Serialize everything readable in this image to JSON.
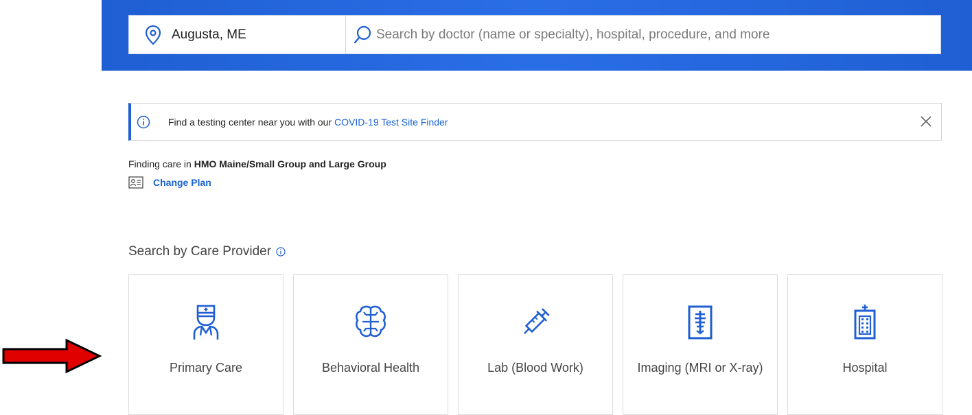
{
  "search": {
    "location_value": "Augusta, ME",
    "query_placeholder": "Search by doctor (name or specialty), hospital, procedure, and more"
  },
  "alert": {
    "text_prefix": "Find a testing center near you with our ",
    "link_text": "COVID-19 Test Site Finder"
  },
  "plan": {
    "prefix": "Finding care in ",
    "name": "HMO Maine/Small Group and Large Group",
    "change_label": "Change Plan"
  },
  "care_provider": {
    "title": "Search by Care Provider",
    "tiles": [
      {
        "label": "Primary Care",
        "icon": "doctor-icon"
      },
      {
        "label": "Behavioral Health",
        "icon": "brain-icon"
      },
      {
        "label": "Lab (Blood Work)",
        "icon": "syringe-icon"
      },
      {
        "label": "Imaging (MRI or X-ray)",
        "icon": "xray-icon"
      },
      {
        "label": "Hospital",
        "icon": "hospital-icon"
      }
    ]
  },
  "colors": {
    "brand_blue": "#1f5fd3",
    "link_blue": "#1a63d4",
    "annotation_arrow": "#e00000"
  }
}
